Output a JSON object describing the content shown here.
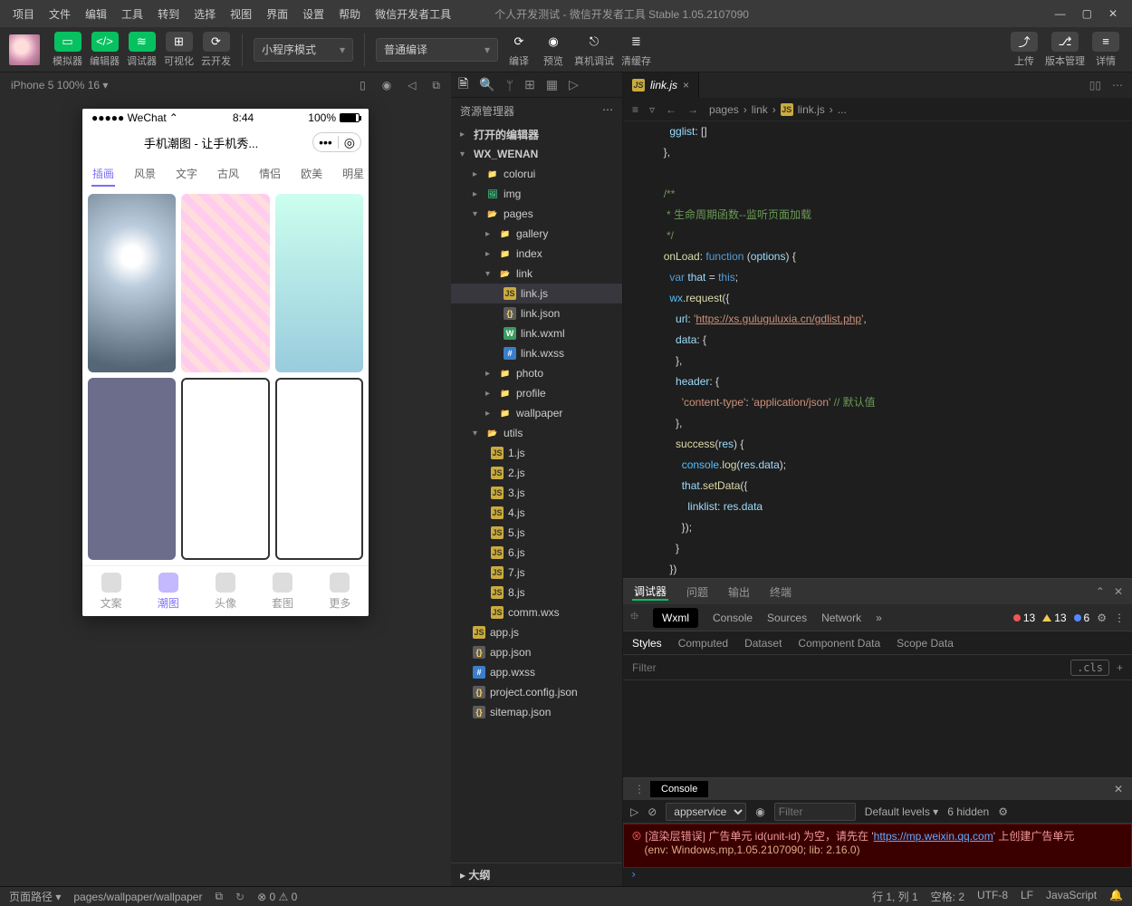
{
  "menu": [
    "项目",
    "文件",
    "编辑",
    "工具",
    "转到",
    "选择",
    "视图",
    "界面",
    "设置",
    "帮助",
    "微信开发者工具"
  ],
  "window_title": "个人开发测试 - 微信开发者工具 Stable 1.05.2107090",
  "toolbar": {
    "modes": [
      "模拟器",
      "编辑器",
      "调试器"
    ],
    "extra": [
      "可视化",
      "云开发"
    ],
    "compile_mode": "小程序模式",
    "scheme": "普通编译",
    "actions": {
      "compile": "编译",
      "preview": "预览",
      "realdebug": "真机调试",
      "clearcache": "清缓存"
    },
    "right": {
      "upload": "上传",
      "version": "版本管理",
      "detail": "详情"
    }
  },
  "sim": {
    "device": "iPhone 5 100% 16",
    "status": {
      "carrier": "●●●●● WeChat",
      "time": "8:44",
      "batt": "100%"
    },
    "nav_title": "手机潮图 - 让手机秀...",
    "tabs": [
      "插画",
      "风景",
      "文字",
      "古风",
      "情侣",
      "欧美",
      "明星"
    ],
    "bottom": [
      "文案",
      "潮图",
      "头像",
      "套图",
      "更多"
    ]
  },
  "explorer": {
    "head": "资源管理器",
    "sections": {
      "open": "打开的编辑器",
      "proj": "WX_WENAN",
      "outline": "大纲"
    },
    "tree": {
      "colorui": "colorui",
      "img": "img",
      "pages": "pages",
      "gallery": "gallery",
      "index": "index",
      "link": "link",
      "linkjs": "link.js",
      "linkjson": "link.json",
      "linkwxml": "link.wxml",
      "linkwxss": "link.wxss",
      "photo": "photo",
      "profile": "profile",
      "wallpaper": "wallpaper",
      "utils": "utils",
      "u1": "1.js",
      "u2": "2.js",
      "u3": "3.js",
      "u4": "4.js",
      "u5": "5.js",
      "u6": "6.js",
      "u7": "7.js",
      "u8": "8.js",
      "uc": "comm.wxs",
      "appjs": "app.js",
      "appjson": "app.json",
      "appwxss": "app.wxss",
      "pcj": "project.config.json",
      "smj": "sitemap.json"
    }
  },
  "editor": {
    "tab": "link.js",
    "breadcrumb": [
      "pages",
      "link",
      "link.js",
      "..."
    ],
    "lines": [
      {
        "n": "",
        "frag": [
          {
            "t": "      ",
            "c": ""
          },
          {
            "t": "gglist",
            "c": "tok-p"
          },
          {
            "t": ": []",
            "c": ""
          }
        ]
      },
      {
        "n": "",
        "frag": [
          {
            "t": "    },",
            "c": ""
          }
        ]
      },
      {
        "n": "",
        "frag": []
      },
      {
        "n": "",
        "frag": [
          {
            "t": "    ",
            "c": ""
          },
          {
            "t": "/**",
            "c": "tok-c"
          }
        ]
      },
      {
        "n": "",
        "frag": [
          {
            "t": "     * 生命周期函数--监听页面加载",
            "c": "tok-c"
          }
        ]
      },
      {
        "n": "",
        "frag": [
          {
            "t": "     */",
            "c": "tok-c"
          }
        ]
      },
      {
        "n": "",
        "frag": [
          {
            "t": "    ",
            "c": ""
          },
          {
            "t": "onLoad",
            "c": "tok-f"
          },
          {
            "t": ": ",
            "c": ""
          },
          {
            "t": "function",
            "c": "tok-k"
          },
          {
            "t": " (",
            "c": ""
          },
          {
            "t": "options",
            "c": "tok-p"
          },
          {
            "t": ") {",
            "c": ""
          }
        ]
      },
      {
        "n": "",
        "frag": [
          {
            "t": "      ",
            "c": ""
          },
          {
            "t": "var",
            "c": "tok-k"
          },
          {
            "t": " ",
            "c": ""
          },
          {
            "t": "that",
            "c": "tok-p"
          },
          {
            "t": " = ",
            "c": ""
          },
          {
            "t": "this",
            "c": "tok-k"
          },
          {
            "t": ";",
            "c": ""
          }
        ]
      },
      {
        "n": "",
        "frag": [
          {
            "t": "      ",
            "c": ""
          },
          {
            "t": "wx",
            "c": "tok-v"
          },
          {
            "t": ".",
            "c": ""
          },
          {
            "t": "request",
            "c": "tok-f"
          },
          {
            "t": "({",
            "c": ""
          }
        ]
      },
      {
        "n": "",
        "frag": [
          {
            "t": "        ",
            "c": ""
          },
          {
            "t": "url",
            "c": "tok-p"
          },
          {
            "t": ": ",
            "c": ""
          },
          {
            "t": "'",
            "c": "tok-s"
          },
          {
            "t": "https://xs.guluguluxia.cn/gdlist.php",
            "c": "tok-su"
          },
          {
            "t": "'",
            "c": "tok-s"
          },
          {
            "t": ",",
            "c": ""
          }
        ]
      },
      {
        "n": "",
        "frag": [
          {
            "t": "        ",
            "c": ""
          },
          {
            "t": "data",
            "c": "tok-p"
          },
          {
            "t": ": {",
            "c": ""
          }
        ]
      },
      {
        "n": "",
        "frag": [
          {
            "t": "        },",
            "c": ""
          }
        ]
      },
      {
        "n": "",
        "frag": [
          {
            "t": "        ",
            "c": ""
          },
          {
            "t": "header",
            "c": "tok-p"
          },
          {
            "t": ": {",
            "c": ""
          }
        ]
      },
      {
        "n": "",
        "frag": [
          {
            "t": "          ",
            "c": ""
          },
          {
            "t": "'content-type'",
            "c": "tok-s"
          },
          {
            "t": ": ",
            "c": ""
          },
          {
            "t": "'application/json'",
            "c": "tok-s"
          },
          {
            "t": " ",
            "c": ""
          },
          {
            "t": "// 默认值",
            "c": "tok-c"
          }
        ]
      },
      {
        "n": "",
        "frag": [
          {
            "t": "        },",
            "c": ""
          }
        ]
      },
      {
        "n": "",
        "frag": [
          {
            "t": "        ",
            "c": ""
          },
          {
            "t": "success",
            "c": "tok-f"
          },
          {
            "t": "(",
            "c": ""
          },
          {
            "t": "res",
            "c": "tok-p"
          },
          {
            "t": ") {",
            "c": ""
          }
        ]
      },
      {
        "n": "",
        "frag": [
          {
            "t": "          ",
            "c": ""
          },
          {
            "t": "console",
            "c": "tok-v"
          },
          {
            "t": ".",
            "c": ""
          },
          {
            "t": "log",
            "c": "tok-f"
          },
          {
            "t": "(",
            "c": ""
          },
          {
            "t": "res",
            "c": "tok-p"
          },
          {
            "t": ".",
            "c": ""
          },
          {
            "t": "data",
            "c": "tok-p"
          },
          {
            "t": ");",
            "c": ""
          }
        ]
      },
      {
        "n": "",
        "frag": [
          {
            "t": "          ",
            "c": ""
          },
          {
            "t": "that",
            "c": "tok-p"
          },
          {
            "t": ".",
            "c": ""
          },
          {
            "t": "setData",
            "c": "tok-f"
          },
          {
            "t": "({",
            "c": ""
          }
        ]
      },
      {
        "n": "",
        "frag": [
          {
            "t": "            ",
            "c": ""
          },
          {
            "t": "linklist",
            "c": "tok-p"
          },
          {
            "t": ": ",
            "c": ""
          },
          {
            "t": "res",
            "c": "tok-p"
          },
          {
            "t": ".",
            "c": ""
          },
          {
            "t": "data",
            "c": "tok-p"
          }
        ]
      },
      {
        "n": "",
        "frag": [
          {
            "t": "          });",
            "c": ""
          }
        ]
      },
      {
        "n": "",
        "frag": [
          {
            "t": "        }",
            "c": ""
          }
        ]
      },
      {
        "n": "",
        "frag": [
          {
            "t": "      })",
            "c": ""
          }
        ]
      }
    ]
  },
  "panel": {
    "tabs": [
      "调试器",
      "问题",
      "输出",
      "终端"
    ],
    "devtabs": [
      "Wxml",
      "Console",
      "Sources",
      "Network"
    ],
    "badges": {
      "err": "13",
      "warn": "13",
      "info": "6"
    },
    "stylestabs": [
      "Styles",
      "Computed",
      "Dataset",
      "Component Data",
      "Scope Data"
    ],
    "filter_ph": "Filter",
    "cls": ".cls",
    "console_tab": "Console",
    "context": "appservice",
    "levels": "Default levels",
    "hidden": "6 hidden",
    "err_text": "[渲染层错误] 广告单元 id(unit-id) 为空，请先在 '",
    "err_link": "https://mp.weixin.qq.com",
    "err_text2": "' 上创建广告单元",
    "env": "(env: Windows,mp,1.05.2107090; lib: 2.16.0)"
  },
  "statusbar": {
    "route": "页面路径",
    "path": "pages/wallpaper/wallpaper",
    "errs": "0",
    "warns": "0",
    "pos": "行 1, 列 1",
    "spaces": "空格: 2",
    "enc": "UTF-8",
    "eol": "LF",
    "lang": "JavaScript"
  }
}
